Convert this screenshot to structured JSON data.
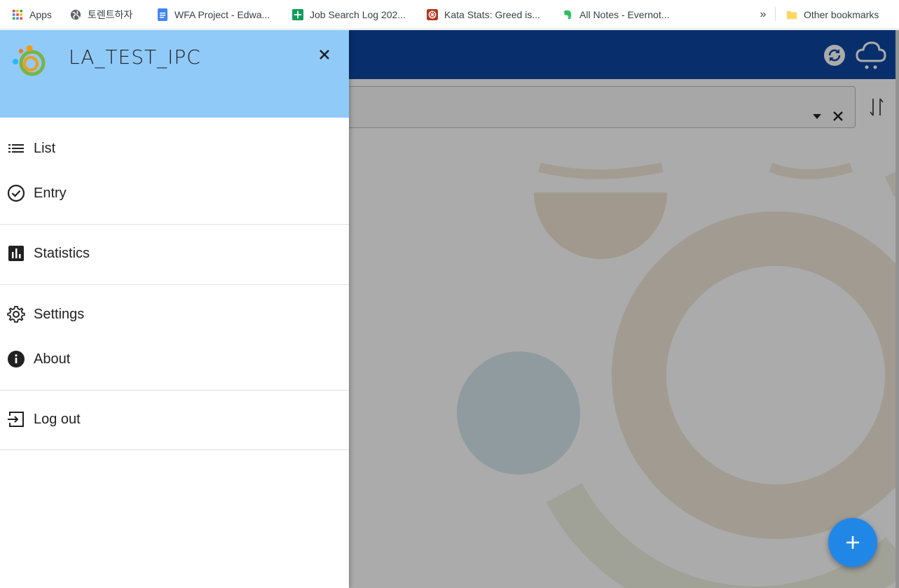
{
  "bookmarks": {
    "items": [
      {
        "label": "Apps",
        "icon": "apps-grid-icon"
      },
      {
        "label": "토렌트하자",
        "icon": "globe-icon"
      },
      {
        "label": "WFA Project - Edwa...",
        "icon": "google-docs-icon"
      },
      {
        "label": "Job Search Log 202...",
        "icon": "google-sheets-icon"
      },
      {
        "label": "Kata Stats: Greed is...",
        "icon": "codewars-icon"
      },
      {
        "label": "All Notes - Evernot...",
        "icon": "evernote-icon"
      }
    ],
    "more_label": "»",
    "other_label": "Other bookmarks"
  },
  "appbar": {
    "color": "#0d47a1",
    "actions": [
      "sync-icon",
      "cloud-icon"
    ]
  },
  "filter": {
    "value": "",
    "sort_icon": "sort-icon"
  },
  "drawer": {
    "title": "LA_TEST_IPC",
    "header_color": "#90caf9",
    "menu": [
      {
        "label": "List",
        "icon": "list-icon"
      },
      {
        "label": "Entry",
        "icon": "check-circle-icon"
      },
      {
        "label": "Statistics",
        "icon": "bar-chart-icon"
      },
      {
        "label": "Settings",
        "icon": "gear-icon"
      },
      {
        "label": "About",
        "icon": "info-icon"
      },
      {
        "label": "Log out",
        "icon": "logout-icon"
      }
    ]
  },
  "fab": {
    "icon": "plus-icon",
    "color": "#2187e7"
  }
}
